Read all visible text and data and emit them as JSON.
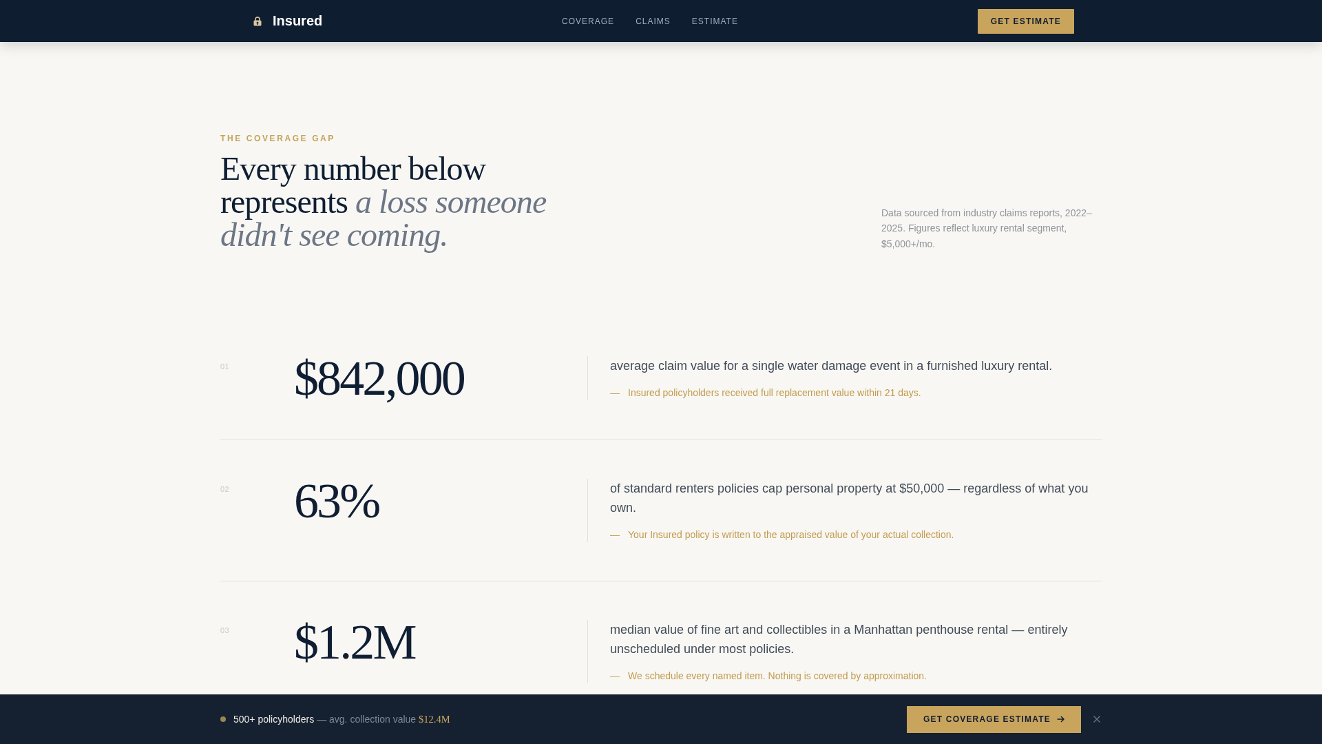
{
  "nav": {
    "brand": "Insured",
    "links": [
      {
        "label": "COVERAGE"
      },
      {
        "label": "CLAIMS"
      },
      {
        "label": "ESTIMATE"
      }
    ],
    "cta": "GET ESTIMATE"
  },
  "header": {
    "eyebrow": "THE COVERAGE GAP",
    "title": "Every number below represents *a loss someone didn't see coming.*",
    "source_note": "Data sourced from industry claims reports, 2022–2025. Figures reflect luxury rental segment, $5,000+/mo."
  },
  "stats": [
    {
      "index": "01",
      "figure": "$842,000",
      "description": "average claim value for a single water damage event in a furnished luxury rental.",
      "note_mark": "—",
      "note": "Insured policyholders received full replacement value within 21 days."
    },
    {
      "index": "02",
      "figure": "63%",
      "description": "of standard renters policies cap personal property at $50,000 — regardless of what you own.",
      "note_mark": "—",
      "note": "Your Insured policy is written to the appraised value of your actual collection."
    },
    {
      "index": "03",
      "figure": "$1.2M",
      "description": "median value of fine art and collectibles in a Manhattan penthouse rental — entirely unscheduled under most policies.",
      "note_mark": "—",
      "note": "We schedule every named item. Nothing is covered by approximation."
    }
  ],
  "bottom_bar": {
    "count": "500+ policyholders",
    "label": "— avg. collection value",
    "value": "$12.4M",
    "cta": "GET COVERAGE ESTIMATE"
  }
}
